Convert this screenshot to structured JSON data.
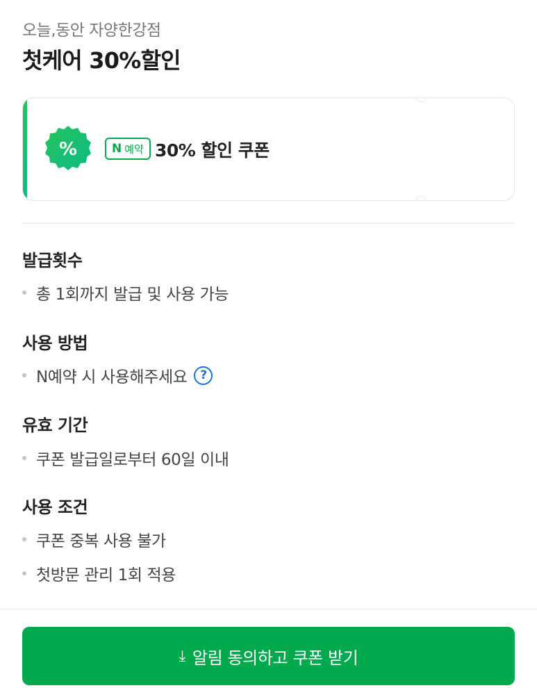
{
  "header": {
    "subtitle": "오늘,동안 자양한강점",
    "title": "첫케어 30%할인"
  },
  "coupon": {
    "badge_symbol": "%",
    "tag_n": "N",
    "tag_text": "예약",
    "label": "30% 할인 쿠폰",
    "accent_color": "#03a94d"
  },
  "sections": [
    {
      "heading": "발급횟수",
      "items": [
        "총 1회까지 발급 및 사용 가능"
      ]
    },
    {
      "heading": "사용 방법",
      "items": [
        "N예약 시 사용해주세요"
      ],
      "help_icon": "?"
    },
    {
      "heading": "유효 기간",
      "items": [
        "쿠폰 발급일로부터 60일 이내"
      ]
    },
    {
      "heading": "사용 조건",
      "items": [
        "쿠폰 중복 사용 불가",
        "첫방문 관리 1회 적용"
      ]
    }
  ],
  "cta": {
    "icon": "⤓",
    "label": "알림 동의하고 쿠폰 받기"
  }
}
